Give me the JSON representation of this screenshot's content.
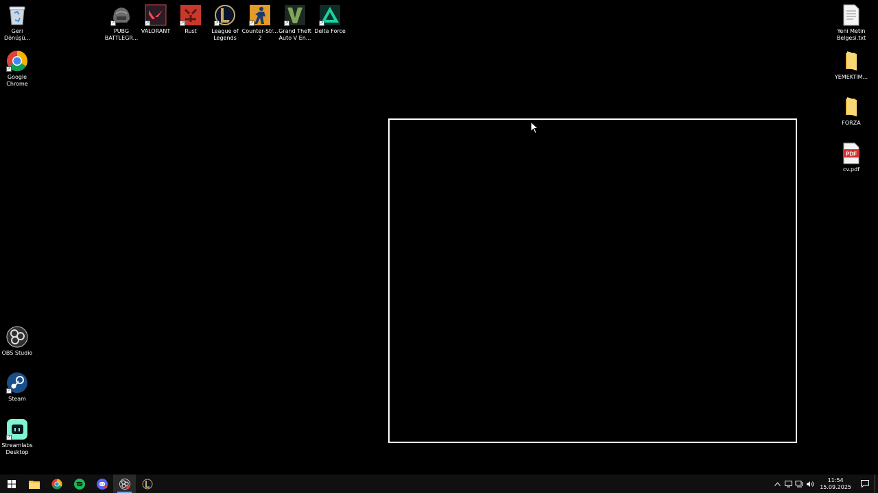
{
  "desktop": {
    "icons_left": [
      {
        "label": "Geri\nDönüşü...",
        "icon": "recycle-bin-icon"
      },
      {
        "label": "Google\nChrome",
        "icon": "chrome-icon"
      },
      {
        "label": "OBS Studio",
        "icon": "obs-icon"
      },
      {
        "label": "Steam",
        "icon": "steam-icon"
      },
      {
        "label": "Streamlabs\nDesktop",
        "icon": "streamlabs-icon"
      }
    ],
    "icons_top": [
      {
        "label": "PUBG\nBATTLEGR...",
        "icon": "pubg-icon"
      },
      {
        "label": "VALORANT",
        "icon": "valorant-icon"
      },
      {
        "label": "Rust",
        "icon": "rust-icon"
      },
      {
        "label": "League of\nLegends",
        "icon": "league-icon"
      },
      {
        "label": "Counter-Str...\n2",
        "icon": "counter-strike-icon"
      },
      {
        "label": "Grand Theft\nAuto V En...",
        "icon": "gta-icon"
      },
      {
        "label": "Delta Force",
        "icon": "delta-force-icon"
      }
    ],
    "icons_right": [
      {
        "label": "Yeni Metin\nBelgesi.txt",
        "icon": "text-file-icon"
      },
      {
        "label": "YEMEKTIM...",
        "icon": "folder-icon"
      },
      {
        "label": "FORZA",
        "icon": "folder-icon"
      },
      {
        "label": "cv.pdf",
        "icon": "pdf-icon"
      }
    ]
  },
  "taskbar": {
    "apps": [
      "start-icon",
      "file-explorer-icon",
      "chrome-icon",
      "spotify-icon",
      "discord-icon",
      "obs-icon",
      "league-icon"
    ],
    "clock": {
      "time": "11:54",
      "date": "15.09.2025"
    },
    "pdf_badge": "PDF"
  },
  "colors": {
    "accent": "#6aa8e8",
    "taskbar": "#101010",
    "background": "#000000"
  }
}
